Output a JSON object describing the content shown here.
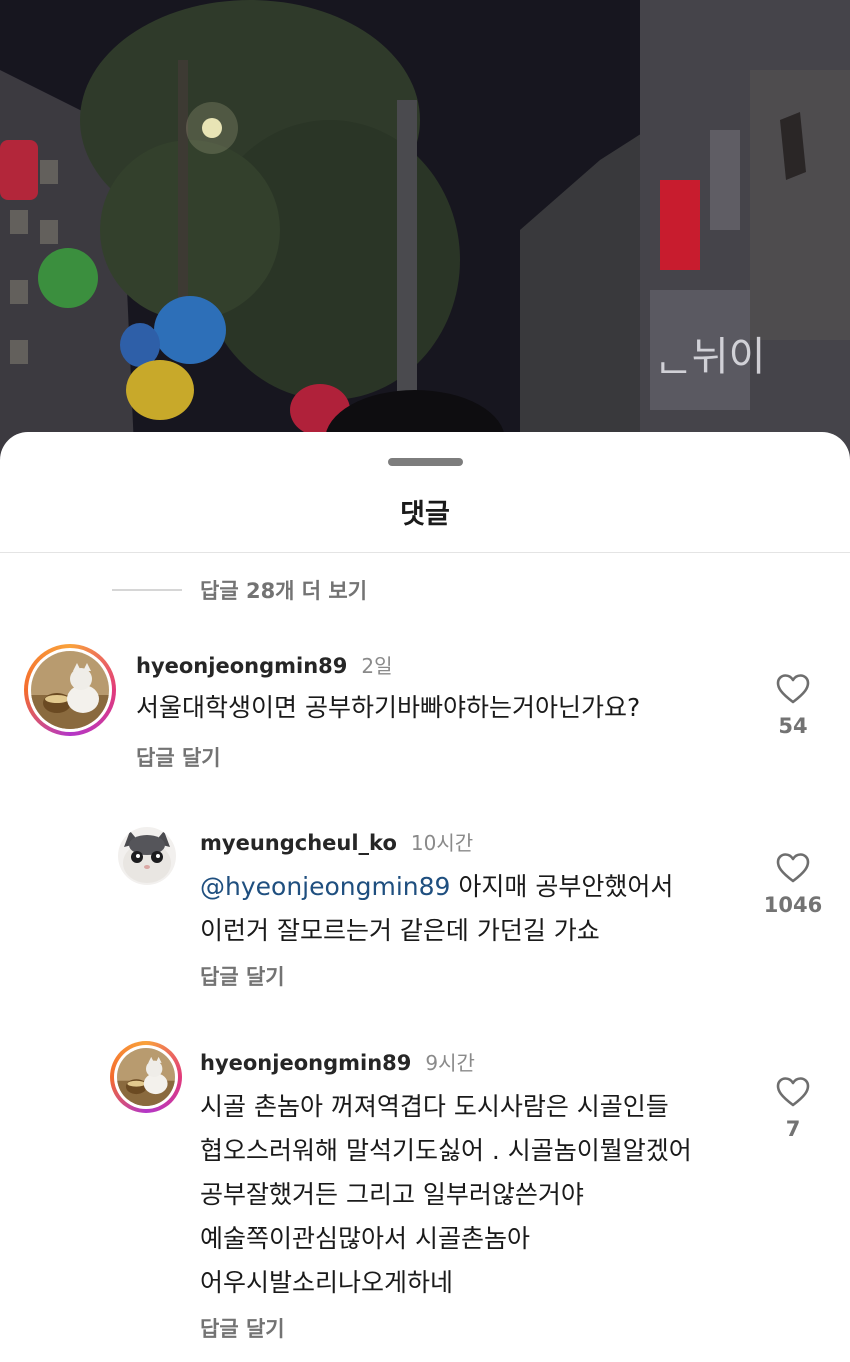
{
  "sheet": {
    "title": "댓글",
    "more_replies": "답글 28개 더 보기"
  },
  "comments": [
    {
      "username": "hyeonjeongmin89",
      "time": "2일",
      "text": "서울대학생이면 공부하기바빠야하는거아닌가요?",
      "reply_label": "답글 달기",
      "likes": "54",
      "avatar_icon": "cat-avatar-icon"
    },
    {
      "username": "myeungcheul_ko",
      "time": "10시간",
      "mention": "@hyeonjeongmin89",
      "text": " 아지매 공부안했어서\n이런거 잘모르는거 같은데 가던길 가쇼",
      "reply_label": "답글 달기",
      "likes": "1046",
      "avatar_icon": "crying-cat-avatar-icon"
    },
    {
      "username": "hyeonjeongmin89",
      "time": "9시간",
      "text": "시골 촌놈아 꺼져역겹다 도시사람은 시골인들\n협오스러워해 말석기도싫어 . 시골놈이뭘알겠어\n공부잘했거든 그리고 일부러않쓴거야\n예술쪽이관심많아서 시골촌놈아\n어우시발소리나오게하네",
      "reply_label": "답글 달기",
      "likes": "7",
      "avatar_icon": "cat-avatar-icon"
    }
  ],
  "colors": {
    "text": "#1a1a1a",
    "muted": "#737373",
    "mention": "#1f4f7f",
    "story_ring_start": "#f9a23b",
    "story_ring_end": "#b336c8"
  }
}
